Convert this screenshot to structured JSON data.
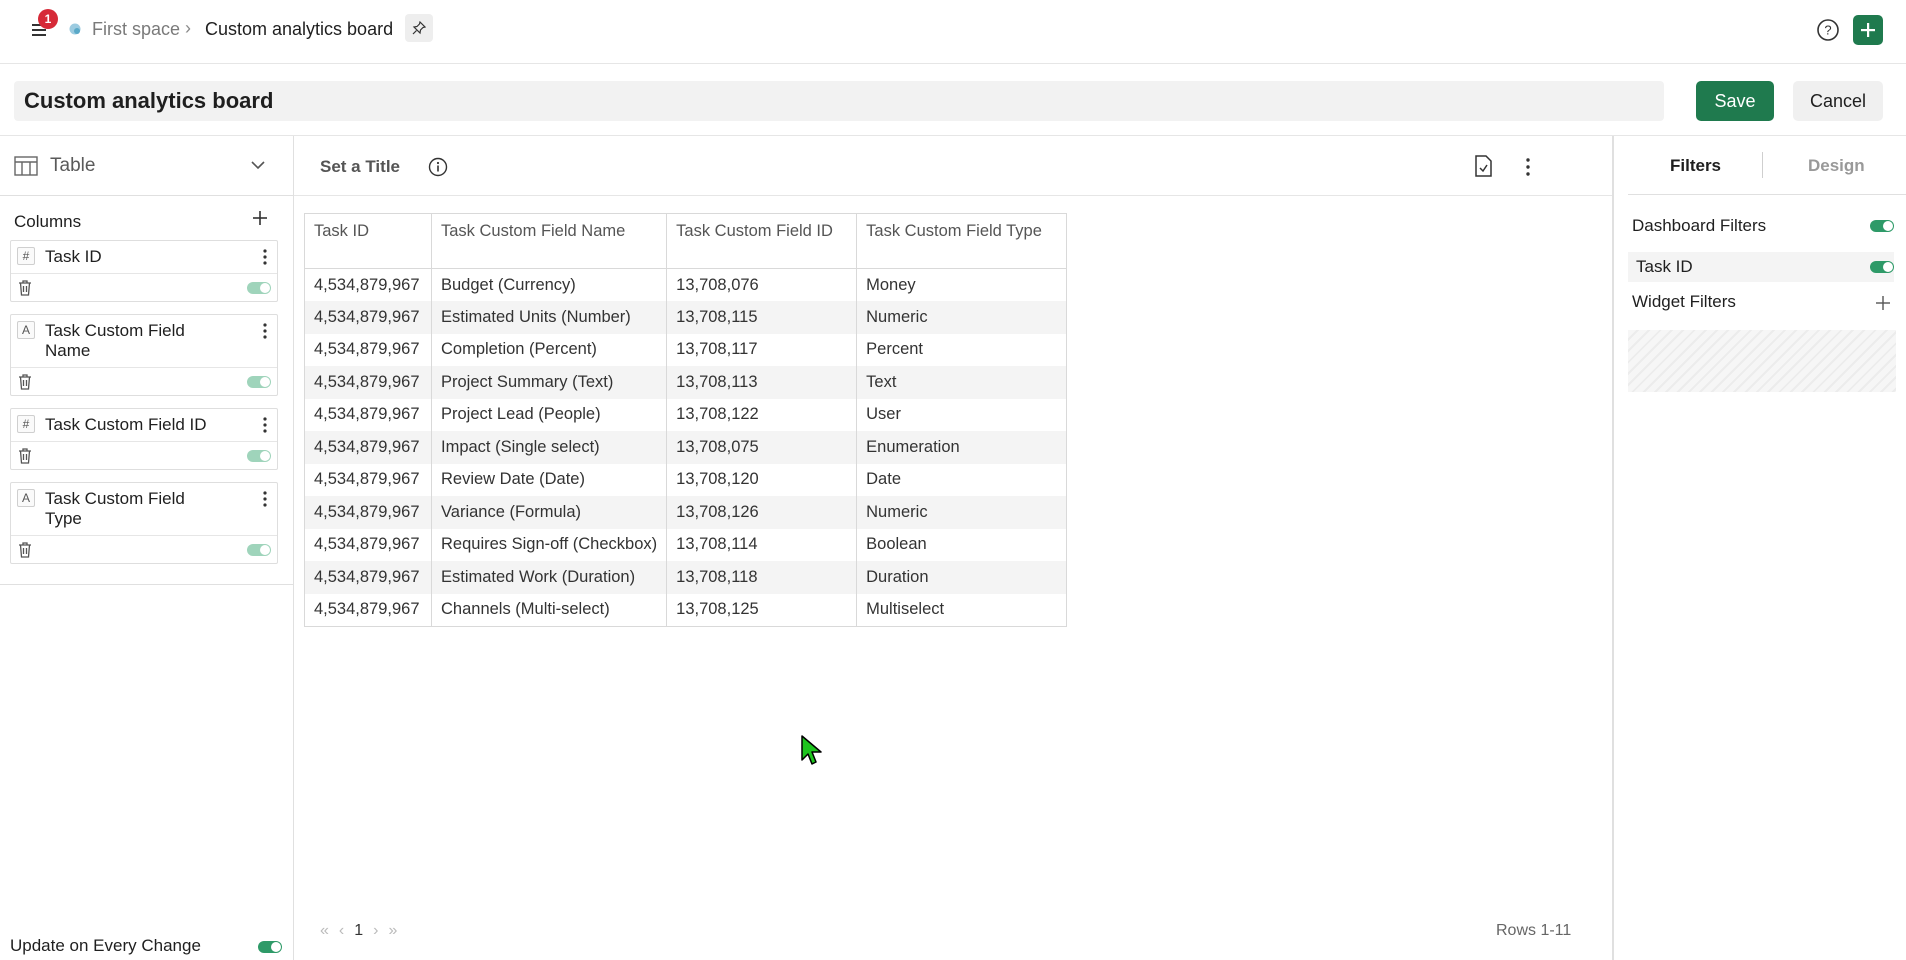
{
  "topbar": {
    "notification_count": "1",
    "breadcrumb_space": "First space",
    "breadcrumb_board": "Custom analytics board"
  },
  "title_row": {
    "board_title": "Custom analytics board",
    "save_label": "Save",
    "cancel_label": "Cancel"
  },
  "left_panel": {
    "visualization_type": "Table",
    "columns_heading": "Columns",
    "columns": [
      {
        "type_icon": "#",
        "name": "Task ID",
        "enabled": true
      },
      {
        "type_icon": "A",
        "name": "Task Custom Field Name",
        "enabled": true
      },
      {
        "type_icon": "#",
        "name": "Task Custom Field ID",
        "enabled": true
      },
      {
        "type_icon": "A",
        "name": "Task Custom Field Type",
        "enabled": true
      }
    ],
    "update_on_change_label": "Update on Every Change",
    "update_on_change": true
  },
  "center": {
    "widget_title": "Set a Title",
    "table": {
      "headers": [
        "Task ID",
        "Task Custom Field Name",
        "Task Custom Field ID",
        "Task Custom Field Type"
      ],
      "rows": [
        [
          "4,534,879,967",
          "Budget (Currency)",
          "13,708,076",
          "Money"
        ],
        [
          "4,534,879,967",
          "Estimated Units (Number)",
          "13,708,115",
          "Numeric"
        ],
        [
          "4,534,879,967",
          "Completion (Percent)",
          "13,708,117",
          "Percent"
        ],
        [
          "4,534,879,967",
          "Project Summary (Text)",
          "13,708,113",
          "Text"
        ],
        [
          "4,534,879,967",
          "Project Lead (People)",
          "13,708,122",
          "User"
        ],
        [
          "4,534,879,967",
          "Impact (Single select)",
          "13,708,075",
          "Enumeration"
        ],
        [
          "4,534,879,967",
          "Review Date (Date)",
          "13,708,120",
          "Date"
        ],
        [
          "4,534,879,967",
          "Variance (Formula)",
          "13,708,126",
          "Numeric"
        ],
        [
          "4,534,879,967",
          "Requires Sign-off (Checkbox)",
          "13,708,114",
          "Boolean"
        ],
        [
          "4,534,879,967",
          "Estimated Work (Duration)",
          "13,708,118",
          "Duration"
        ],
        [
          "4,534,879,967",
          "Channels (Multi-select)",
          "13,708,125",
          "Multiselect"
        ]
      ]
    },
    "pagination": {
      "first": "«",
      "prev": "‹",
      "page": "1",
      "next": "›",
      "last": "»"
    },
    "rows_info": "Rows 1-11"
  },
  "right_panel": {
    "tabs": [
      "Filters",
      "Design"
    ],
    "active_tab": "Filters",
    "dashboard_filters_label": "Dashboard Filters",
    "dashboard_filters_enabled": true,
    "filter_items": [
      {
        "label": "Task ID",
        "enabled": true
      }
    ],
    "widget_filters_label": "Widget Filters"
  },
  "colors": {
    "primary": "#1f7a4e",
    "badge": "#d62a38",
    "toggle_on": "#2e9a68"
  }
}
